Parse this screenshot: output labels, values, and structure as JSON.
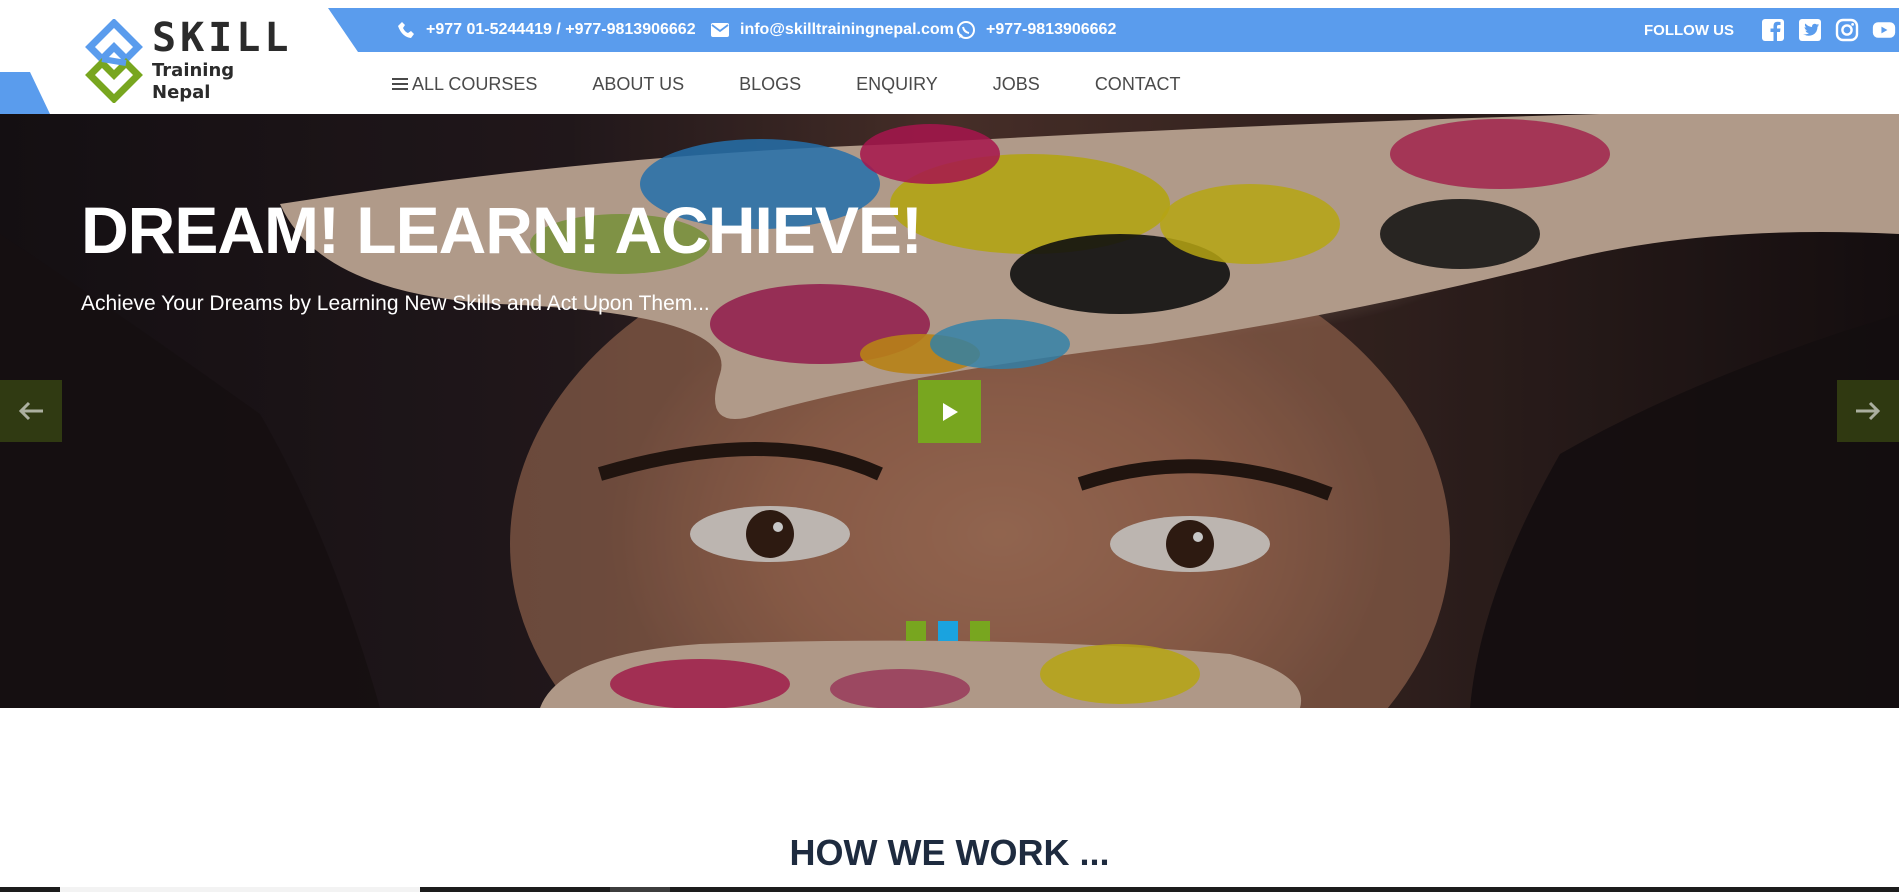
{
  "brand": {
    "name": "SKILL",
    "tagline": "Training Nepal",
    "colors": {
      "primary_blue": "#5a9ced",
      "accent_green": "#78a61f",
      "heading_dark": "#1e2b3f"
    }
  },
  "topbar": {
    "phone": {
      "icon": "phone-icon",
      "text": "+977 01-5244419 / +977-9813906662"
    },
    "email": {
      "icon": "envelope-icon",
      "text": "info@skilltrainingnepal.com"
    },
    "whatsapp": {
      "icon": "whatsapp-icon",
      "text": "+977-9813906662"
    },
    "follow_label": "FOLLOW US",
    "social": [
      "facebook-icon",
      "twitter-icon",
      "instagram-icon",
      "youtube-icon"
    ]
  },
  "nav": {
    "items": [
      {
        "label": "ALL COURSES",
        "icon": "menu-icon"
      },
      {
        "label": "ABOUT US"
      },
      {
        "label": "BLOGS"
      },
      {
        "label": "ENQUIRY"
      },
      {
        "label": "JOBS"
      },
      {
        "label": "CONTACT"
      }
    ]
  },
  "hero": {
    "title": "DREAM! LEARN! ACHIEVE!",
    "subtitle": "Achieve Your Dreams by Learning New Skills and Act Upon Them...",
    "slide_dots": [
      {
        "color": "#78a61f",
        "active": false
      },
      {
        "color": "#1aa3df",
        "active": true
      },
      {
        "color": "#78a61f",
        "active": false
      }
    ]
  },
  "section": {
    "title": "HOW WE WORK ..."
  }
}
